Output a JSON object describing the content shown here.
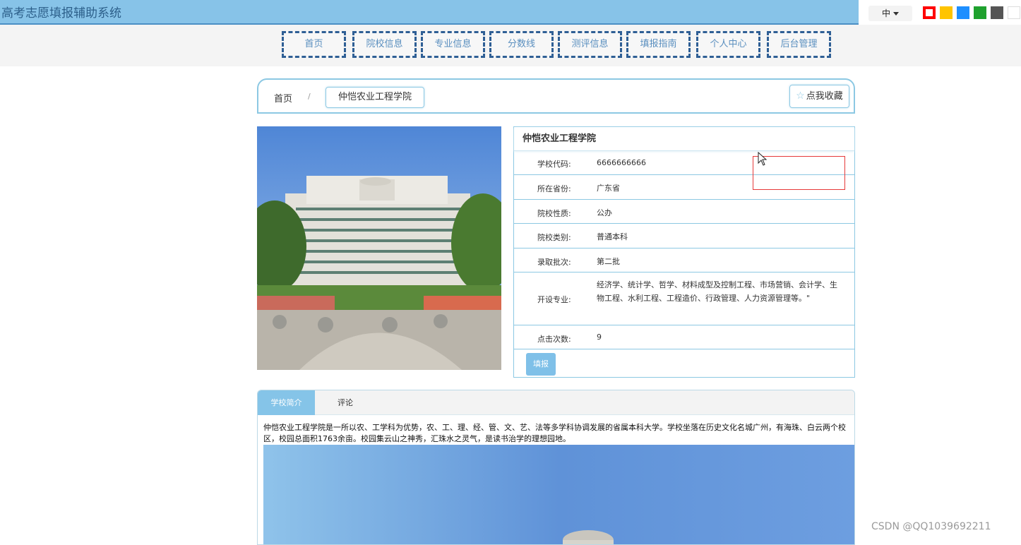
{
  "app": {
    "title": "高考志愿填报辅助系统"
  },
  "top_right": {
    "language": "中",
    "theme_colors": [
      "#ff0000",
      "#ffc400",
      "#1e8fff",
      "#1fa12e",
      "#555555",
      "#ffffff"
    ]
  },
  "nav": {
    "items": [
      "首页",
      "院校信息",
      "专业信息",
      "分数线",
      "测评信息",
      "填报指南",
      "个人中心",
      "后台管理"
    ]
  },
  "breadcrumb": {
    "home": "首页",
    "separator": "/",
    "current": "仲恺农业工程学院",
    "favorite_label": "点我收藏"
  },
  "school": {
    "name": "仲恺农业工程学院",
    "fields": [
      {
        "label": "学校代码:",
        "value": "6666666666"
      },
      {
        "label": "所在省份:",
        "value": "广东省"
      },
      {
        "label": "院校性质:",
        "value": "公办"
      },
      {
        "label": "院校类别:",
        "value": "普通本科"
      },
      {
        "label": "录取批次:",
        "value": "第二批"
      },
      {
        "label": "开设专业:",
        "value": "经济学、统计学、哲学、材料成型及控制工程、市场营销、会计学、生物工程、水利工程、工程造价、行政管理、人力资源管理等。\""
      },
      {
        "label": "点击次数:",
        "value": "9"
      }
    ],
    "apply_button": "填报"
  },
  "tabs": {
    "items": [
      "学校简介",
      "评论"
    ],
    "intro_text": "仲恺农业工程学院是一所以农、工学科为优势，农、工、理、经、管、文、艺、法等多学科协调发展的省属本科大学。学校坐落在历史文化名城广州，有海珠、白云两个校区，校园总面积1763余亩。校园集云山之神秀，汇珠水之灵气，是读书治学的理想园地。"
  },
  "watermark": "CSDN @QQ1039692211"
}
